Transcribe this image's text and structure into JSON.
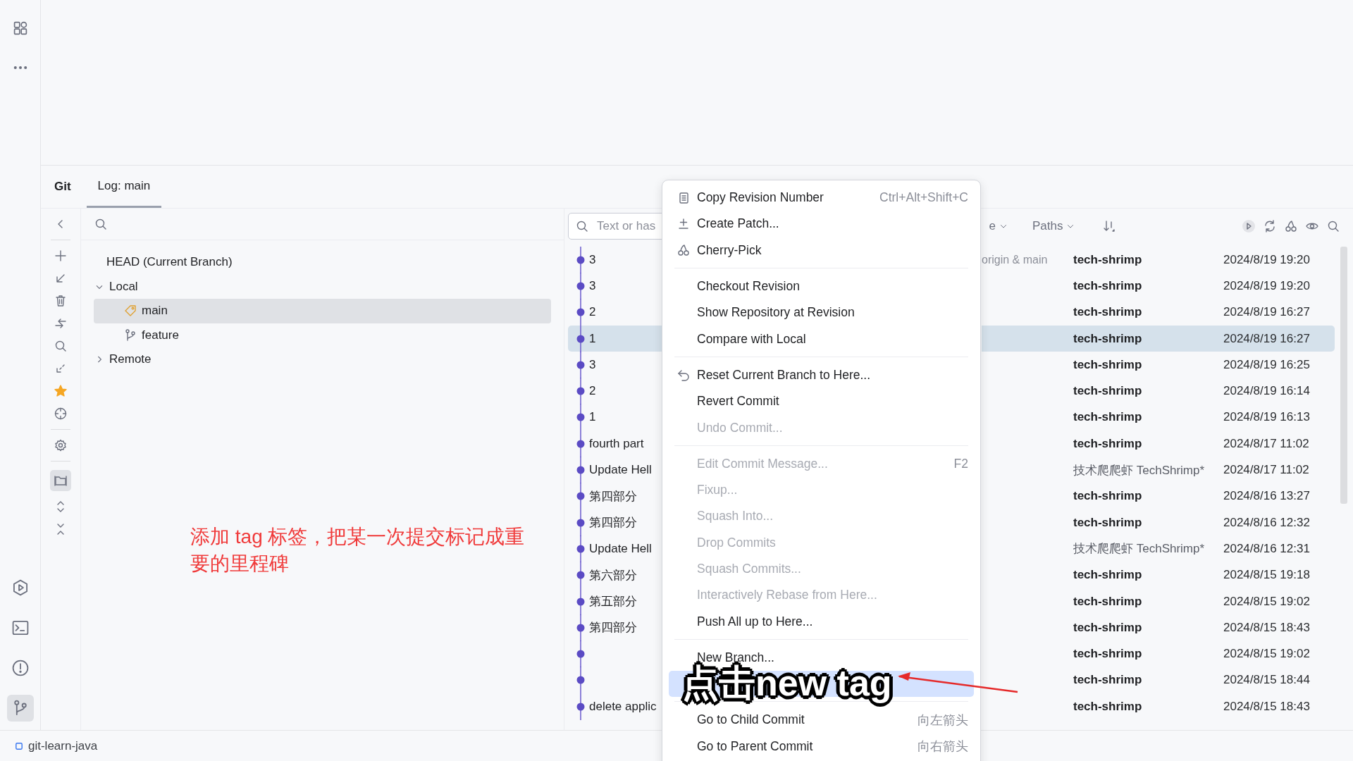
{
  "tool_window": {
    "title": "Git",
    "tabs": [
      {
        "label": "Log: main",
        "selected": true
      }
    ]
  },
  "branches": {
    "tree": [
      {
        "label": "HEAD (Current Branch)",
        "kind": "head",
        "selected": false
      },
      {
        "label": "Local",
        "kind": "folder",
        "expanded": true,
        "selected": false,
        "children": [
          {
            "label": "main",
            "kind": "tag",
            "selected": true
          },
          {
            "label": "feature",
            "kind": "branch",
            "selected": false
          }
        ]
      },
      {
        "label": "Remote",
        "kind": "folder",
        "expanded": false,
        "selected": false
      }
    ]
  },
  "annotation": "添加 tag 标签，把某一次提交标记成重要的里程碑",
  "log": {
    "search_placeholder": "Text or has",
    "filter_fragment": "e",
    "paths_filter": "Paths",
    "commits": [
      {
        "message": "3",
        "refs": "origin & main",
        "author": "tech-shrimp",
        "author_bold": true,
        "date": "2024/8/19 19:20",
        "selected": false
      },
      {
        "message": "3",
        "author": "tech-shrimp",
        "author_bold": true,
        "date": "2024/8/19 19:20",
        "selected": false
      },
      {
        "message": "2",
        "author": "tech-shrimp",
        "author_bold": true,
        "date": "2024/8/19 16:27",
        "selected": false
      },
      {
        "message": "1",
        "author": "tech-shrimp",
        "author_bold": true,
        "date": "2024/8/19 16:27",
        "selected": true
      },
      {
        "message": "3",
        "author": "tech-shrimp",
        "author_bold": true,
        "date": "2024/8/19 16:25",
        "selected": false
      },
      {
        "message": "2",
        "author": "tech-shrimp",
        "author_bold": true,
        "date": "2024/8/19 16:14",
        "selected": false
      },
      {
        "message": "1",
        "author": "tech-shrimp",
        "author_bold": true,
        "date": "2024/8/19 16:13",
        "selected": false
      },
      {
        "message": "fourth part",
        "author": "tech-shrimp",
        "author_bold": true,
        "date": "2024/8/17 11:02",
        "selected": false
      },
      {
        "message": "Update Hell",
        "author": "技术爬爬虾 TechShrimp*",
        "author_bold": false,
        "date": "2024/8/17 11:02",
        "selected": false
      },
      {
        "message": "第四部分",
        "author": "tech-shrimp",
        "author_bold": true,
        "date": "2024/8/16 13:27",
        "selected": false
      },
      {
        "message": "第四部分",
        "author": "tech-shrimp",
        "author_bold": true,
        "date": "2024/8/16 12:32",
        "selected": false
      },
      {
        "message": "Update Hell",
        "author": "技术爬爬虾 TechShrimp*",
        "author_bold": false,
        "date": "2024/8/16 12:31",
        "selected": false
      },
      {
        "message": "第六部分",
        "author": "tech-shrimp",
        "author_bold": true,
        "date": "2024/8/15 19:18",
        "selected": false
      },
      {
        "message": "第五部分",
        "author": "tech-shrimp",
        "author_bold": true,
        "date": "2024/8/15 19:02",
        "selected": false
      },
      {
        "message": "第四部分",
        "author": "tech-shrimp",
        "author_bold": true,
        "date": "2024/8/15 18:43",
        "selected": false
      },
      {
        "author": "tech-shrimp",
        "author_bold": true,
        "date": "2024/8/15 19:02",
        "selected": false
      },
      {
        "author": "tech-shrimp",
        "author_bold": true,
        "date": "2024/8/15 18:44",
        "selected": false
      },
      {
        "message": "delete applic",
        "author": "tech-shrimp",
        "author_bold": true,
        "date": "2024/8/15 18:43",
        "selected": false
      }
    ]
  },
  "context_menu": {
    "groups": [
      [
        {
          "label": "Copy Revision Number",
          "kind": "copy",
          "shortcut": "Ctrl+Alt+Shift+C",
          "disabled": false,
          "selected": false
        },
        {
          "label": "Create Patch...",
          "kind": "patch",
          "disabled": false,
          "selected": false
        },
        {
          "label": "Cherry-Pick",
          "kind": "cherry",
          "disabled": false,
          "selected": false
        }
      ],
      [
        {
          "label": "Checkout Revision",
          "disabled": false,
          "selected": false
        },
        {
          "label": "Show Repository at Revision",
          "disabled": false,
          "selected": false
        },
        {
          "label": "Compare with Local",
          "disabled": false,
          "selected": false
        }
      ],
      [
        {
          "label": "Reset Current Branch to Here...",
          "kind": "reset",
          "disabled": false,
          "selected": false
        },
        {
          "label": "Revert Commit",
          "disabled": false,
          "selected": false
        },
        {
          "label": "Undo Commit...",
          "disabled": true,
          "selected": false
        }
      ],
      [
        {
          "label": "Edit Commit Message...",
          "shortcut": "F2",
          "disabled": true,
          "selected": false
        },
        {
          "label": "Fixup...",
          "disabled": true,
          "selected": false
        },
        {
          "label": "Squash Into...",
          "disabled": true,
          "selected": false
        },
        {
          "label": "Drop Commits",
          "disabled": true,
          "selected": false
        },
        {
          "label": "Squash Commits...",
          "disabled": true,
          "selected": false
        },
        {
          "label": "Interactively Rebase from Here...",
          "disabled": true,
          "selected": false
        },
        {
          "label": "Push All up to Here...",
          "disabled": false,
          "selected": false
        }
      ],
      [
        {
          "label": "New Branch...",
          "disabled": false,
          "selected": false
        },
        {
          "disabled": false,
          "selected": true
        }
      ],
      [
        {
          "label": "Go to Child Commit",
          "shortcut": "向左箭头",
          "disabled": false,
          "selected": false
        },
        {
          "label": "Go to Parent Commit",
          "shortcut": "向右箭头",
          "disabled": false,
          "selected": false
        }
      ]
    ]
  },
  "caption": "点击new tag",
  "status_bar": {
    "project": "git-learn-java"
  }
}
